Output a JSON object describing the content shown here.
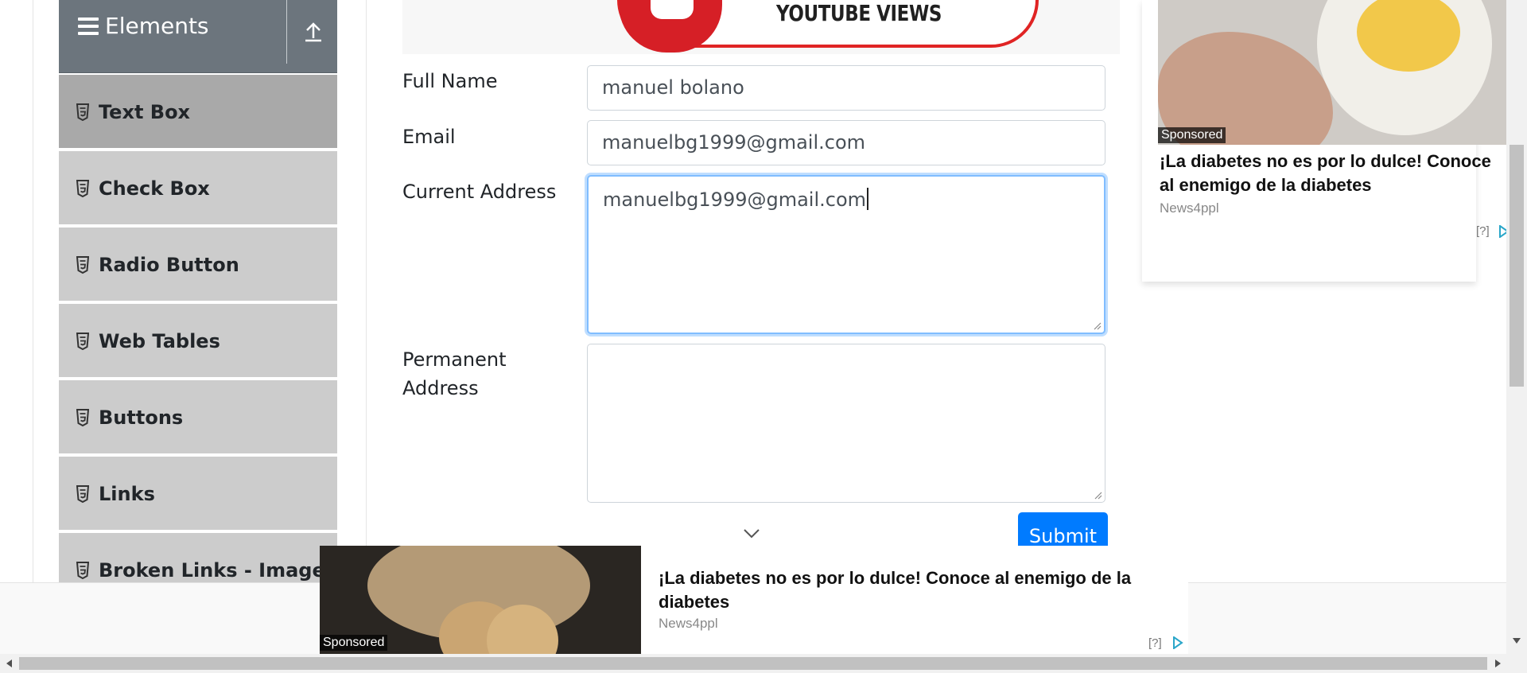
{
  "sidebar": {
    "group_title": "Elements",
    "items": [
      {
        "label": "Text Box"
      },
      {
        "label": "Check Box"
      },
      {
        "label": "Radio Button"
      },
      {
        "label": "Web Tables"
      },
      {
        "label": "Buttons"
      },
      {
        "label": "Links"
      },
      {
        "label": "Broken Links - Images"
      }
    ],
    "active_item": "Text Box"
  },
  "banner": {
    "text": "YOUTUBE VIEWS"
  },
  "form": {
    "full_name": {
      "label": "Full Name",
      "value": "manuel bolano"
    },
    "email": {
      "label": "Email",
      "value": "manuelbg1999@gmail.com"
    },
    "current_address": {
      "label": "Current Address",
      "value": "manuelbg1999@gmail.com"
    },
    "permanent_address": {
      "label_line1": "Permanent",
      "label_line2": "Address",
      "value": ""
    },
    "submit_label": "Submit"
  },
  "ad_right": {
    "tag": "Sponsored",
    "headline": "¡La diabetes no es por lo dulce! Conoce al enemigo de la diabetes",
    "source": "News4ppl",
    "help": "[?]"
  },
  "ad_bottom": {
    "tag": "Sponsored",
    "headline": "¡La diabetes no es por lo dulce! Conoce al enemigo de la diabetes",
    "source": "News4ppl",
    "help": "[?]"
  },
  "colors": {
    "sidebar_header": "#6c757d",
    "sidebar_item": "#cccccc",
    "sidebar_active": "#a9a9a9",
    "primary": "#007bff",
    "focus_border": "#80bdff"
  }
}
